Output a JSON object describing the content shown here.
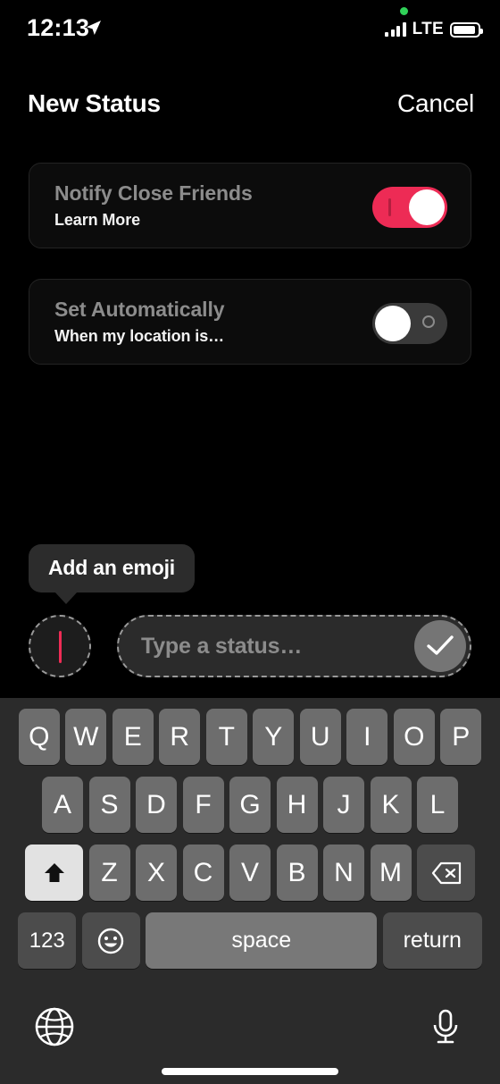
{
  "status_bar": {
    "time": "12:13",
    "location_icon": "location-arrow-icon",
    "recording_dot": "green-privacy-dot",
    "signal_icon": "cellular-signal-icon",
    "network": "LTE",
    "battery_icon": "battery-icon"
  },
  "header": {
    "title": "New Status",
    "cancel_label": "Cancel"
  },
  "settings": {
    "notify": {
      "title": "Notify Close Friends",
      "subtitle": "Learn More",
      "toggle_state": "on",
      "toggle_mark": "1",
      "accent_color": "#ED2B55"
    },
    "automatic": {
      "title": "Set Automatically",
      "subtitle": "When my location is…",
      "toggle_state": "off",
      "toggle_mark": "0",
      "track_color": "#3A3A3A"
    }
  },
  "tooltip": {
    "text": "Add an emoji"
  },
  "composer": {
    "emoji_slot_name": "emoji-picker",
    "caret_color": "#EF2C55",
    "placeholder": "Type a status…",
    "value": "",
    "submit_icon": "check-icon",
    "submit_color": "#757575"
  },
  "keyboard": {
    "row1": [
      "Q",
      "W",
      "E",
      "R",
      "T",
      "Y",
      "U",
      "I",
      "O",
      "P"
    ],
    "row2": [
      "A",
      "S",
      "D",
      "F",
      "G",
      "H",
      "J",
      "K",
      "L"
    ],
    "row3": [
      "Z",
      "X",
      "C",
      "V",
      "B",
      "N",
      "M"
    ],
    "shift_icon": "shift-arrow-icon",
    "shift_state": "active",
    "backspace_icon": "backspace-icon",
    "numbers_label": "123",
    "emoji_icon": "smiley-face-icon",
    "space_label": "space",
    "return_label": "return"
  },
  "bottom_bar": {
    "globe_icon": "globe-icon",
    "mic_icon": "microphone-icon",
    "home_indicator": "home-indicator"
  }
}
